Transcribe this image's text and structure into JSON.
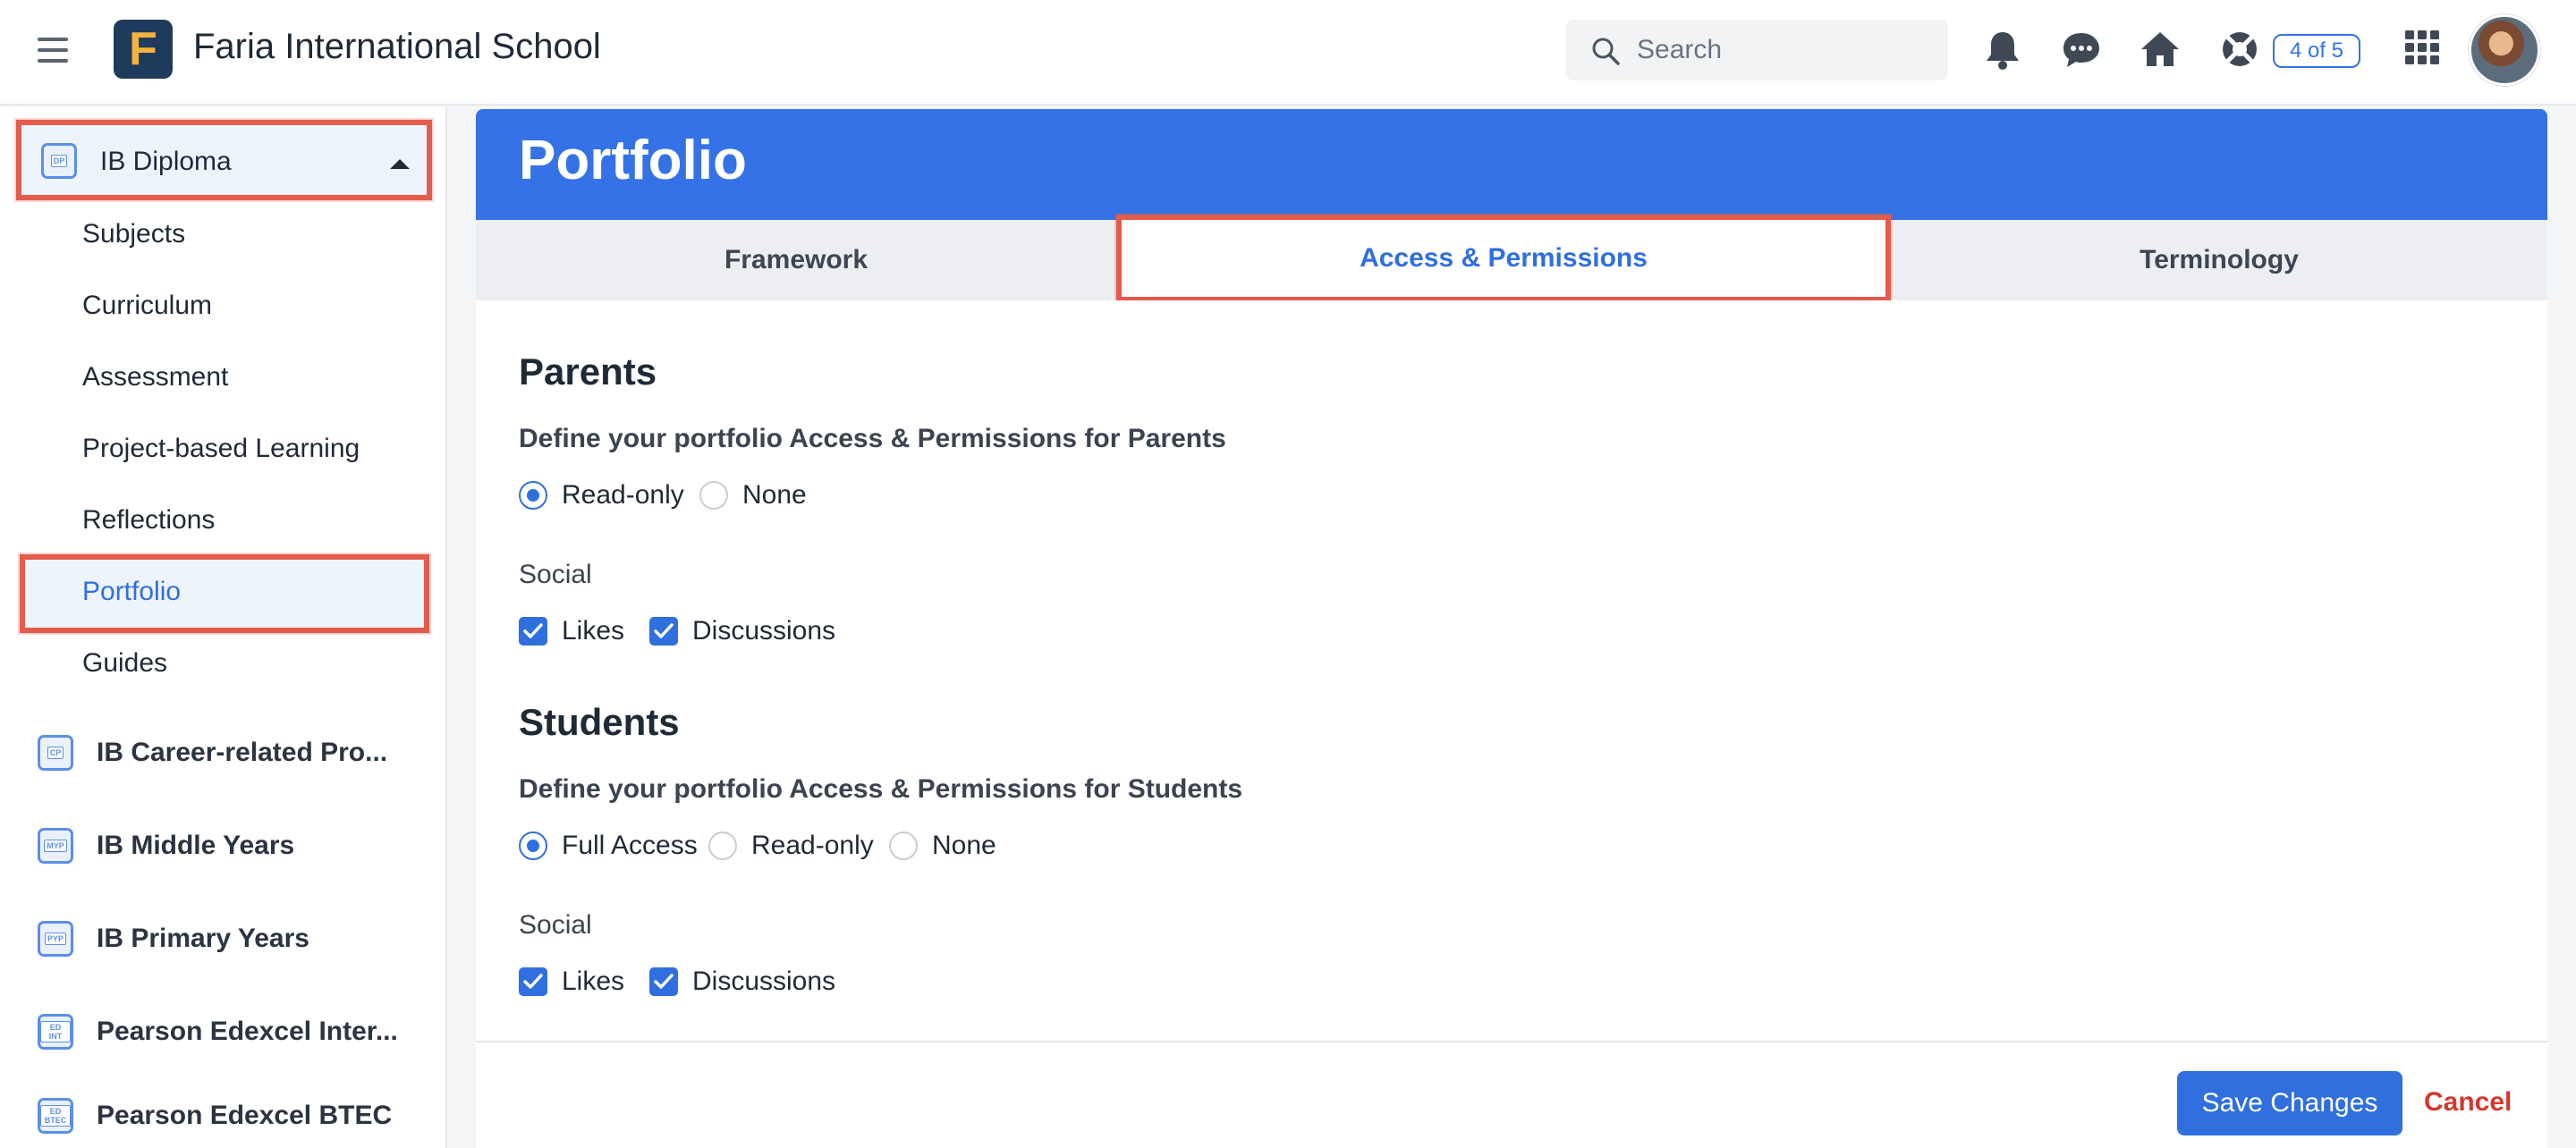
{
  "header": {
    "org_name": "Faria International School",
    "logo_letter": "F",
    "search_placeholder": "Search",
    "badge": "4 of 5",
    "icons": [
      "hamburger-icon",
      "bell-icon",
      "chat-icon",
      "home-icon",
      "lifebuoy-icon",
      "apps-grid-icon",
      "avatar"
    ]
  },
  "sidebar": {
    "expanded_program": {
      "label": "IB Diploma",
      "icon_text": "DP"
    },
    "sub_items": [
      "Subjects",
      "Curriculum",
      "Assessment",
      "Project-based Learning",
      "Reflections",
      "Portfolio",
      "Guides"
    ],
    "active_item": "Portfolio",
    "programs": [
      {
        "label": "IB Career-related Pro...",
        "icon_text": "CP"
      },
      {
        "label": "IB Middle Years",
        "icon_text": "MYP"
      },
      {
        "label": "IB Primary Years",
        "icon_text": "PYP"
      },
      {
        "label": "Pearson Edexcel Inter...",
        "icon_text": "ED INT"
      },
      {
        "label": "Pearson Edexcel BTEC",
        "icon_text": "ED BTEC"
      }
    ]
  },
  "main": {
    "title": "Portfolio",
    "tabs": [
      "Framework",
      "Access & Permissions",
      "Terminology"
    ],
    "active_tab": "Access & Permissions",
    "parents": {
      "heading": "Parents",
      "description": "Define your portfolio Access & Permissions for Parents",
      "options": [
        "Read-only",
        "None"
      ],
      "selected": "Read-only",
      "social_label": "Social",
      "social": [
        {
          "label": "Likes",
          "checked": true
        },
        {
          "label": "Discussions",
          "checked": true
        }
      ]
    },
    "students": {
      "heading": "Students",
      "description": "Define your portfolio Access & Permissions for Students",
      "options": [
        "Full Access",
        "Read-only",
        "None"
      ],
      "selected": "Full Access",
      "social_label": "Social",
      "social": [
        {
          "label": "Likes",
          "checked": true
        },
        {
          "label": "Discussions",
          "checked": true
        }
      ]
    }
  },
  "footer": {
    "save_label": "Save Changes",
    "cancel_label": "Cancel"
  },
  "colors": {
    "accent": "#3472e6",
    "highlight": "#e35c4c",
    "danger": "#d2392b",
    "logo_bg": "#1f3b5c",
    "logo_fg": "#f3b33d"
  }
}
